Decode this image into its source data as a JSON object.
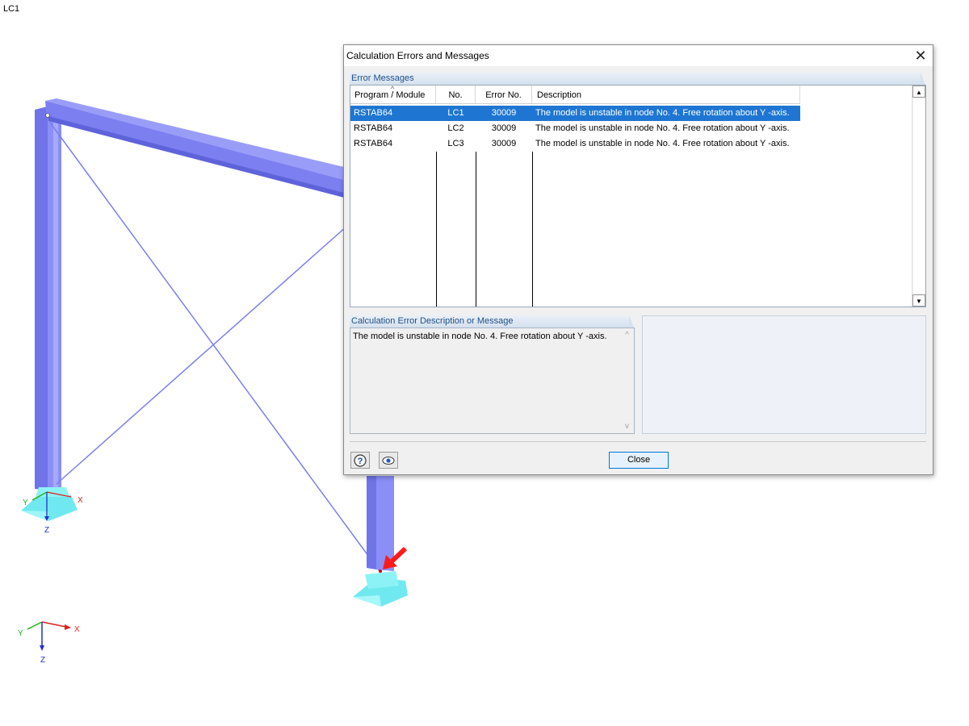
{
  "viewport": {
    "load_case_label": "LC1"
  },
  "dialog": {
    "title": "Calculation Errors and Messages",
    "error_messages_header": "Error Messages",
    "columns": [
      "Program / Module",
      "No.",
      "Error No.",
      "Description"
    ],
    "rows": [
      {
        "program": "RSTAB64",
        "no": "LC1",
        "error_no": "30009",
        "description": "The model is unstable in node No. 4. Free rotation about Y -axis.",
        "selected": true
      },
      {
        "program": "RSTAB64",
        "no": "LC2",
        "error_no": "30009",
        "description": "The model is unstable in node No. 4. Free rotation about Y -axis.",
        "selected": false
      },
      {
        "program": "RSTAB64",
        "no": "LC3",
        "error_no": "30009",
        "description": "The model is unstable in node No. 4. Free rotation about Y -axis.",
        "selected": false
      }
    ],
    "description_header": "Calculation Error Description or Message",
    "description_text": "The model is unstable in node No. 4. Free rotation about Y -axis.",
    "close_label": "Close"
  },
  "axes": {
    "x": "X",
    "y": "Y",
    "z": "Z"
  },
  "colors": {
    "member": "#7b7ff0",
    "support": "#7ef0f4",
    "selection": "#1e76d2",
    "marker_arrow": "#ff1a1a"
  }
}
